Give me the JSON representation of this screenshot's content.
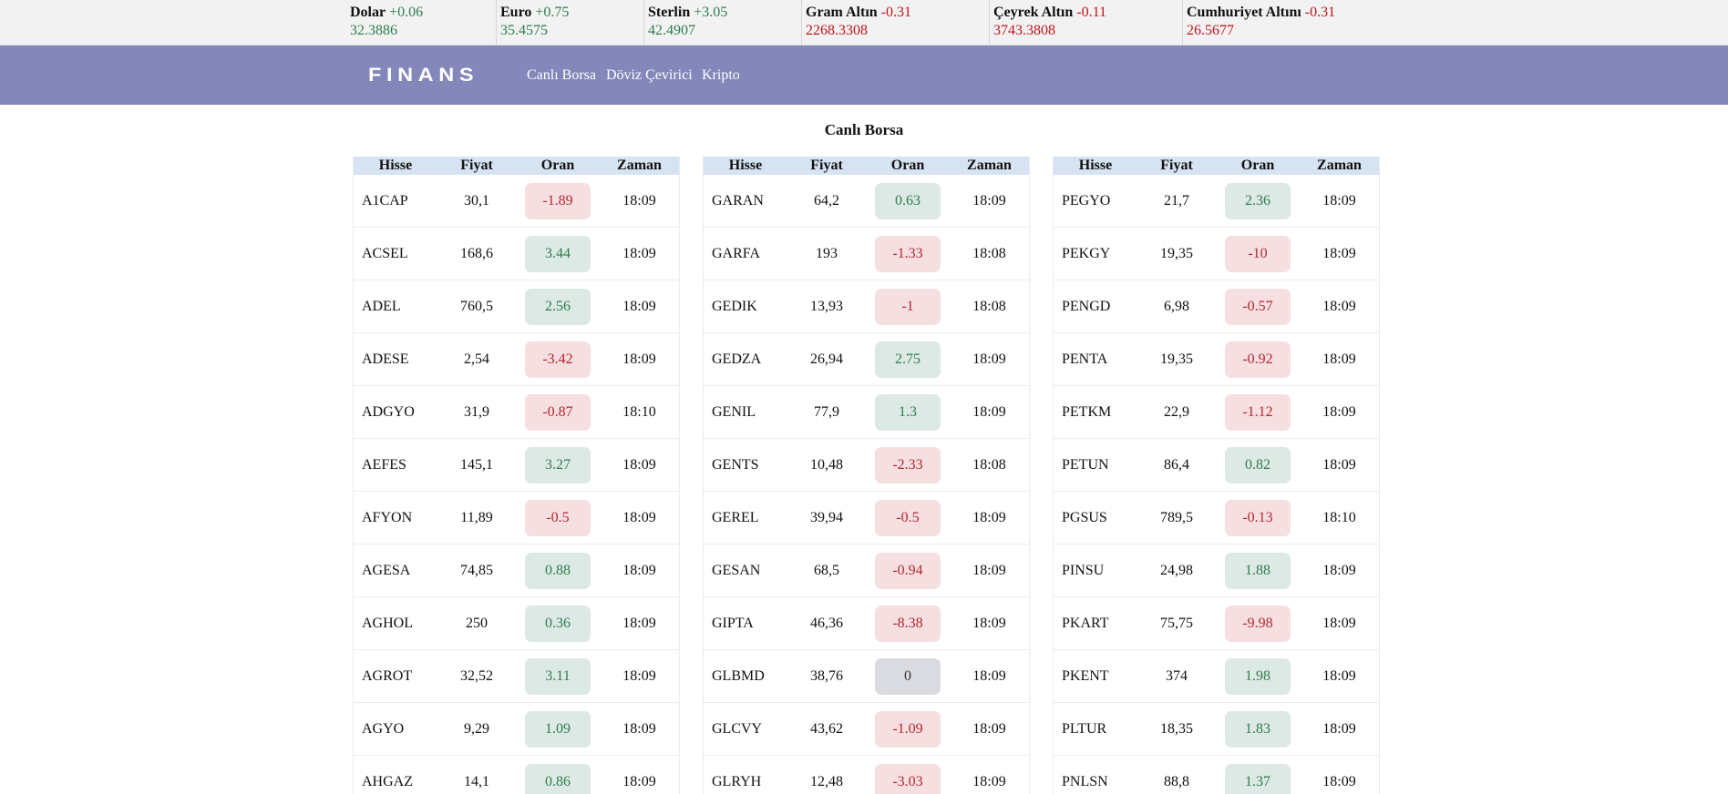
{
  "ticker": [
    {
      "name": "Dolar",
      "change": "+0.06",
      "value": "32.3886",
      "dir": "up"
    },
    {
      "name": "Euro",
      "change": "+0.75",
      "value": "35.4575",
      "dir": "up"
    },
    {
      "name": "Sterlin",
      "change": "+3.05",
      "value": "42.4907",
      "dir": "up"
    },
    {
      "name": "Gram Altın",
      "change": "-0.31",
      "value": "2268.3308",
      "dir": "down"
    },
    {
      "name": "Çeyrek Altın",
      "change": "-0.11",
      "value": "3743.3808",
      "dir": "down"
    },
    {
      "name": "Cumhuriyet Altını",
      "change": "-0.31",
      "value": "26.5677",
      "dir": "down"
    }
  ],
  "nav": {
    "logo": "FINANS",
    "links": [
      "Canlı Borsa",
      "Döviz Çevirici",
      "Kripto"
    ]
  },
  "page_title": "Canlı Borsa",
  "table_headers": [
    "Hisse",
    "Fiyat",
    "Oran",
    "Zaman"
  ],
  "tables": [
    {
      "rows": [
        {
          "hisse": "A1CAP",
          "fiyat": "30,1",
          "oran": "-1.89",
          "zaman": "18:09"
        },
        {
          "hisse": "ACSEL",
          "fiyat": "168,6",
          "oran": "3.44",
          "zaman": "18:09"
        },
        {
          "hisse": "ADEL",
          "fiyat": "760,5",
          "oran": "2.56",
          "zaman": "18:09"
        },
        {
          "hisse": "ADESE",
          "fiyat": "2,54",
          "oran": "-3.42",
          "zaman": "18:09"
        },
        {
          "hisse": "ADGYO",
          "fiyat": "31,9",
          "oran": "-0.87",
          "zaman": "18:10"
        },
        {
          "hisse": "AEFES",
          "fiyat": "145,1",
          "oran": "3.27",
          "zaman": "18:09"
        },
        {
          "hisse": "AFYON",
          "fiyat": "11,89",
          "oran": "-0.5",
          "zaman": "18:09"
        },
        {
          "hisse": "AGESA",
          "fiyat": "74,85",
          "oran": "0.88",
          "zaman": "18:09"
        },
        {
          "hisse": "AGHOL",
          "fiyat": "250",
          "oran": "0.36",
          "zaman": "18:09"
        },
        {
          "hisse": "AGROT",
          "fiyat": "32,52",
          "oran": "3.11",
          "zaman": "18:09"
        },
        {
          "hisse": "AGYO",
          "fiyat": "9,29",
          "oran": "1.09",
          "zaman": "18:09"
        },
        {
          "hisse": "AHGAZ",
          "fiyat": "14,1",
          "oran": "0.86",
          "zaman": "18:09"
        }
      ]
    },
    {
      "rows": [
        {
          "hisse": "GARAN",
          "fiyat": "64,2",
          "oran": "0.63",
          "zaman": "18:09"
        },
        {
          "hisse": "GARFA",
          "fiyat": "193",
          "oran": "-1.33",
          "zaman": "18:08"
        },
        {
          "hisse": "GEDIK",
          "fiyat": "13,93",
          "oran": "-1",
          "zaman": "18:08"
        },
        {
          "hisse": "GEDZA",
          "fiyat": "26,94",
          "oran": "2.75",
          "zaman": "18:09"
        },
        {
          "hisse": "GENIL",
          "fiyat": "77,9",
          "oran": "1.3",
          "zaman": "18:09"
        },
        {
          "hisse": "GENTS",
          "fiyat": "10,48",
          "oran": "-2.33",
          "zaman": "18:08"
        },
        {
          "hisse": "GEREL",
          "fiyat": "39,94",
          "oran": "-0.5",
          "zaman": "18:09"
        },
        {
          "hisse": "GESAN",
          "fiyat": "68,5",
          "oran": "-0.94",
          "zaman": "18:09"
        },
        {
          "hisse": "GIPTA",
          "fiyat": "46,36",
          "oran": "-8.38",
          "zaman": "18:09"
        },
        {
          "hisse": "GLBMD",
          "fiyat": "38,76",
          "oran": "0",
          "zaman": "18:09"
        },
        {
          "hisse": "GLCVY",
          "fiyat": "43,62",
          "oran": "-1.09",
          "zaman": "18:09"
        },
        {
          "hisse": "GLRYH",
          "fiyat": "12,48",
          "oran": "-3.03",
          "zaman": "18:09"
        }
      ]
    },
    {
      "rows": [
        {
          "hisse": "PEGYO",
          "fiyat": "21,7",
          "oran": "2.36",
          "zaman": "18:09"
        },
        {
          "hisse": "PEKGY",
          "fiyat": "19,35",
          "oran": "-10",
          "zaman": "18:09"
        },
        {
          "hisse": "PENGD",
          "fiyat": "6,98",
          "oran": "-0.57",
          "zaman": "18:09"
        },
        {
          "hisse": "PENTA",
          "fiyat": "19,35",
          "oran": "-0.92",
          "zaman": "18:09"
        },
        {
          "hisse": "PETKM",
          "fiyat": "22,9",
          "oran": "-1.12",
          "zaman": "18:09"
        },
        {
          "hisse": "PETUN",
          "fiyat": "86,4",
          "oran": "0.82",
          "zaman": "18:09"
        },
        {
          "hisse": "PGSUS",
          "fiyat": "789,5",
          "oran": "-0.13",
          "zaman": "18:10"
        },
        {
          "hisse": "PINSU",
          "fiyat": "24,98",
          "oran": "1.88",
          "zaman": "18:09"
        },
        {
          "hisse": "PKART",
          "fiyat": "75,75",
          "oran": "-9.98",
          "zaman": "18:09"
        },
        {
          "hisse": "PKENT",
          "fiyat": "374",
          "oran": "1.98",
          "zaman": "18:09"
        },
        {
          "hisse": "PLTUR",
          "fiyat": "18,35",
          "oran": "1.83",
          "zaman": "18:09"
        },
        {
          "hisse": "PNLSN",
          "fiyat": "88,8",
          "oran": "1.37",
          "zaman": "18:09"
        }
      ]
    }
  ]
}
